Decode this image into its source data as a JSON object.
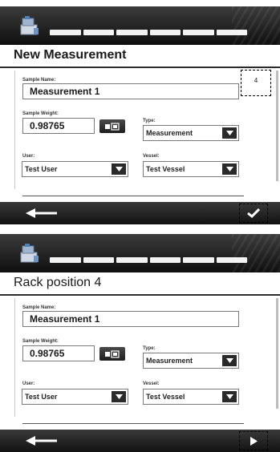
{
  "screens": [
    {
      "title": "New Measurement",
      "badge": "4",
      "sample_name": {
        "label": "Sample Name:",
        "value": "Measurement 1"
      },
      "sample_weight": {
        "label": "Sample Weight:",
        "value": "0.98765"
      },
      "type": {
        "label": "Type:",
        "value": "Measurement"
      },
      "user": {
        "label": "User:",
        "value": "Test User"
      },
      "vessel": {
        "label": "Vessel:",
        "value": "Test Vessel"
      },
      "footer": {
        "back_icon": "arrow-left-icon",
        "action_icon": "checkmark-icon"
      }
    },
    {
      "title": "Rack position 4",
      "sample_name": {
        "label": "Sample Name:",
        "value": "Measurement 1"
      },
      "sample_weight": {
        "label": "Sample Weight:",
        "value": "0.98765"
      },
      "type": {
        "label": "Type:",
        "value": "Measurement"
      },
      "user": {
        "label": "User:",
        "value": "Test User"
      },
      "vessel": {
        "label": "Vessel:",
        "value": "Test Vessel"
      },
      "footer": {
        "back_icon": "arrow-left-icon",
        "action_icon": "play-icon"
      }
    }
  ],
  "progress_segments": 6,
  "colors": {
    "bar_dark": "#1a1a1a",
    "field_border": "#7a7a7a",
    "segment": "#f2f2f2"
  }
}
